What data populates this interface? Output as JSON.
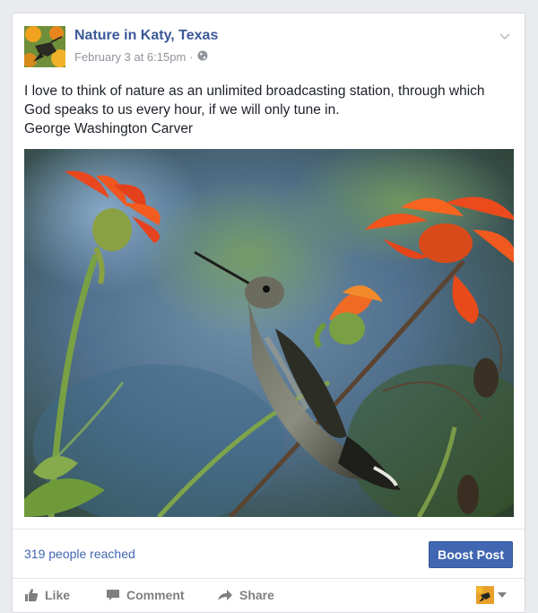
{
  "post": {
    "page_name": "Nature in Katy, Texas",
    "timestamp": "February 3 at 6:15pm",
    "separator": "·",
    "audience_icon": "globe-icon",
    "text_lines": [
      "I love to think of nature as an unlimited broadcasting station, through which",
      "God speaks to us every hour, if we will only tune in.",
      "George Washington Carver"
    ],
    "photo_subject": "hummingbird-with-orange-flowers"
  },
  "insights": {
    "reach": "319 people reached",
    "boost_label": "Boost Post"
  },
  "actions": {
    "like": "Like",
    "comment": "Comment",
    "share": "Share"
  },
  "colors": {
    "brand": "#3b5998",
    "button": "#4267b2",
    "muted": "#90949c"
  }
}
